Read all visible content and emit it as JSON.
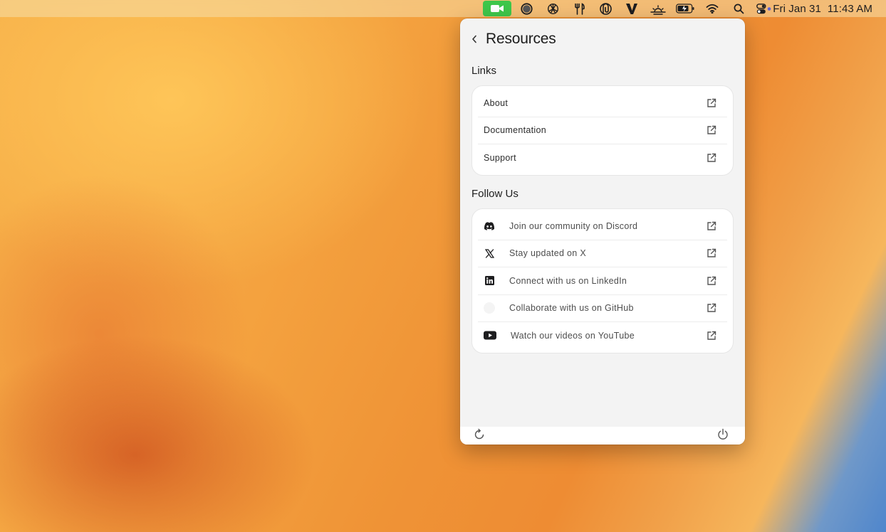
{
  "menubar": {
    "date": "Fri Jan 31",
    "time": "11:43 AM",
    "icons": [
      "video-camera-icon",
      "circle-app-icon",
      "openai-icon",
      "fork-knife-icon",
      "paperclip-icon",
      "v-app-icon",
      "sunrise-icon",
      "battery-icon",
      "wifi-icon",
      "search-icon",
      "control-center-icon"
    ]
  },
  "panel": {
    "title": "Resources",
    "links_heading": "Links",
    "links": [
      {
        "label": "About",
        "icon": "external-link-icon"
      },
      {
        "label": "Documentation",
        "icon": "external-link-icon"
      },
      {
        "label": "Support",
        "icon": "external-link-icon"
      }
    ],
    "follow_heading": "Follow Us",
    "social": [
      {
        "label": "Join our community on Discord",
        "icon": "discord-icon"
      },
      {
        "label": "Stay updated on X",
        "icon": "x-icon"
      },
      {
        "label": "Connect with us on LinkedIn",
        "icon": "linkedin-icon"
      },
      {
        "label": "Collaborate with us on GitHub",
        "icon": "github-icon"
      },
      {
        "label": "Watch our videos on YouTube",
        "icon": "youtube-icon"
      }
    ],
    "footer": {
      "left_icon": "refresh-icon",
      "right_icon": "power-icon"
    }
  },
  "colors": {
    "accent_green": "#3ec64a",
    "panel_bg": "#f3f3f3",
    "card_bg": "#ffffff"
  }
}
